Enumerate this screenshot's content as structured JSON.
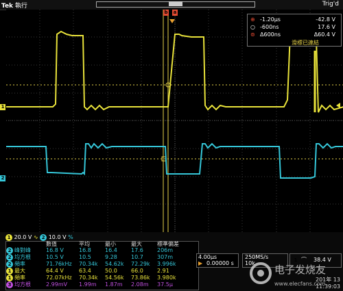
{
  "topbar": {
    "brand": "Tek",
    "mode": "執行",
    "trig_status": "Trig'd"
  },
  "readout": {
    "rows": [
      {
        "marker": "a",
        "time": "-1.20μs",
        "value": "-42.8 V"
      },
      {
        "marker": "b",
        "time": "-600ns",
        "value": "17.6 V"
      },
      {
        "marker": "Δ",
        "time": "Δ600ns",
        "value": "Δ60.4 V"
      }
    ],
    "status": "滑標已連結"
  },
  "scales": {
    "ch1_badge": "1",
    "ch1_scale": "20.0 V",
    "ch2_badge": "2",
    "ch2_scale": "10.0 V",
    "extra": "%"
  },
  "measurements": {
    "headers": [
      "",
      "",
      "數值",
      "平均",
      "最小",
      "最大",
      "標準偏差"
    ],
    "rows": [
      {
        "ch": "2",
        "name": "峰對峰",
        "value": "16.8 V",
        "mean": "16.8",
        "min": "16.4",
        "max": "17.6",
        "std": "206m",
        "color": "#35c6d8"
      },
      {
        "ch": "2",
        "name": "均方根",
        "value": "10.5 V",
        "mean": "10.5",
        "min": "9.28",
        "max": "10.7",
        "std": "307m",
        "color": "#35c6d8"
      },
      {
        "ch": "2",
        "name": "頻率",
        "value": "71.76kHz",
        "mean": "70.34k",
        "min": "54.62k",
        "max": "72.29k",
        "std": "3.996k",
        "color": "#35c6d8"
      },
      {
        "ch": "1",
        "name": "最大",
        "value": "64.4 V",
        "mean": "63.4",
        "min": "50.0",
        "max": "66.0",
        "std": "2.91",
        "color": "#e8e23a"
      },
      {
        "ch": "1",
        "name": "頻率",
        "value": "72.07kHz",
        "mean": "70.34k",
        "min": "54.56k",
        "max": "73.86k",
        "std": "3.980k",
        "color": "#e8e23a"
      },
      {
        "ch": "3",
        "name": "均方根",
        "value": "2.99mV",
        "mean": "1.99m",
        "min": "1.87m",
        "max": "2.08m",
        "std": "37.5μ",
        "color": "#c050e0"
      }
    ]
  },
  "timebase": {
    "scale": "4.00μs",
    "delay": "0.00000 s"
  },
  "acq": {
    "rate": "250MS/s",
    "points": "10k"
  },
  "trigger": {
    "ch": "1",
    "level": "38.4 V"
  },
  "clock": {
    "date": "201年 13",
    "time": "11:39:03"
  },
  "colors": {
    "ch1": "#e8e23a",
    "ch2": "#35c6d8",
    "cursor": "#e8d34a",
    "marker": "#e34b32"
  }
}
